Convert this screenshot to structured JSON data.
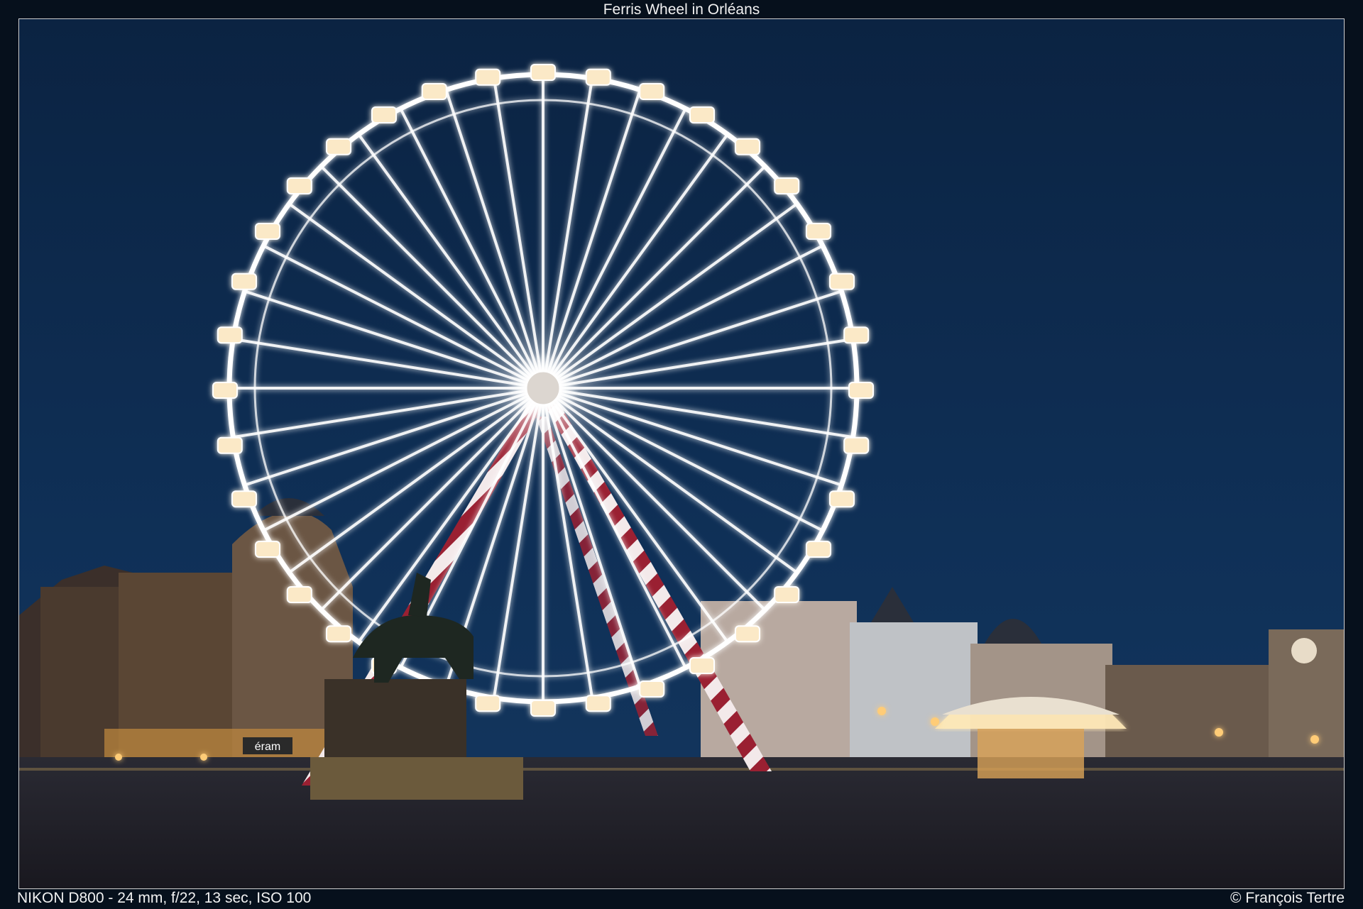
{
  "caption": {
    "title": "Ferris Wheel in Orléans"
  },
  "footer": {
    "exif": "NIKON D800 - 24 mm, f/22, 13 sec, ISO 100",
    "credit": "© François Tertre"
  },
  "photo": {
    "scene": [
      "ferris-wheel",
      "equestrian-statue",
      "carousel",
      "city-square",
      "night-sky"
    ],
    "colors": {
      "sky": "#0d2a4f",
      "wheel_light": "#ffffff",
      "leg_stripe": "#9a2032",
      "warm_light": "#ffcc77"
    },
    "signs": {
      "shop_sign": "éram"
    },
    "wheel": {
      "spokes": 40,
      "gondolas": 36
    }
  }
}
